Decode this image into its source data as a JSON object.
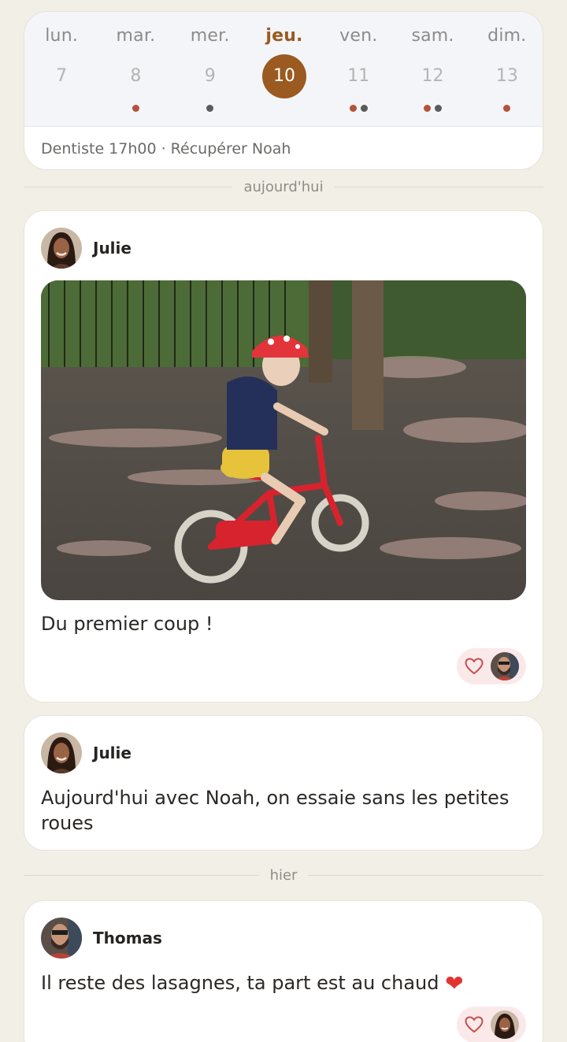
{
  "calendar": {
    "days": [
      {
        "name": "lun.",
        "num": "7"
      },
      {
        "name": "mar.",
        "num": "8"
      },
      {
        "name": "mer.",
        "num": "9"
      },
      {
        "name": "jeu.",
        "num": "10"
      },
      {
        "name": "ven.",
        "num": "11"
      },
      {
        "name": "sam.",
        "num": "12"
      },
      {
        "name": "dim.",
        "num": "13"
      }
    ],
    "today_index": 3,
    "event_dots": [
      [],
      [
        "red"
      ],
      [
        "grey"
      ],
      [],
      [
        "red",
        "grey"
      ],
      [
        "red",
        "grey"
      ],
      [
        "red"
      ]
    ],
    "agenda": "Dentiste 17h00 · Récupérer Noah"
  },
  "separators": {
    "today": "aujourd'hui",
    "yesterday": "hier"
  },
  "posts": [
    {
      "author": "Julie",
      "text": "Du premier coup !",
      "has_photo": true,
      "photo_icon": "child-on-red-bike-photo",
      "reaction_icon": "heart-outline-icon",
      "reactor": "Thomas"
    },
    {
      "author": "Julie",
      "text": "Aujourd'hui avec Noah, on essaie sans les petites roues"
    },
    {
      "author": "Thomas",
      "text": "Il reste des lasagnes, ta part est au chaud",
      "emoji": "❤",
      "reaction_icon": "heart-outline-icon",
      "reactor": "Julie"
    }
  ],
  "colors": {
    "background": "#f2efe7",
    "accent": "#9a5a20",
    "dot_red": "#b4533a",
    "dot_grey": "#5b5b5b",
    "reaction_bg": "#fbe9ea",
    "heart": "#c0504d"
  }
}
